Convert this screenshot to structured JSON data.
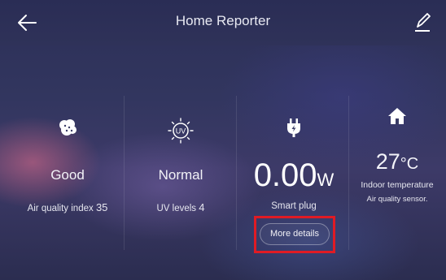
{
  "header": {
    "title": "Home Reporter"
  },
  "cards": {
    "air": {
      "value": "Good",
      "caption_label": "Air quality index",
      "caption_value": "35",
      "icon": "air-quality-icon"
    },
    "uv": {
      "value": "Normal",
      "caption_label": "UV levels",
      "caption_value": "4",
      "icon": "uv-icon"
    },
    "plug": {
      "value": "0.00",
      "unit": "W",
      "caption": "Smart plug",
      "button_label": "More details",
      "icon": "plug-icon"
    },
    "temp": {
      "value": "27",
      "unit": "°C",
      "caption": "Indoor temperature",
      "source": "Air quality sensor.",
      "icon": "home-icon"
    }
  },
  "colors": {
    "highlight": "#e01b24",
    "background": "#2f3259"
  }
}
